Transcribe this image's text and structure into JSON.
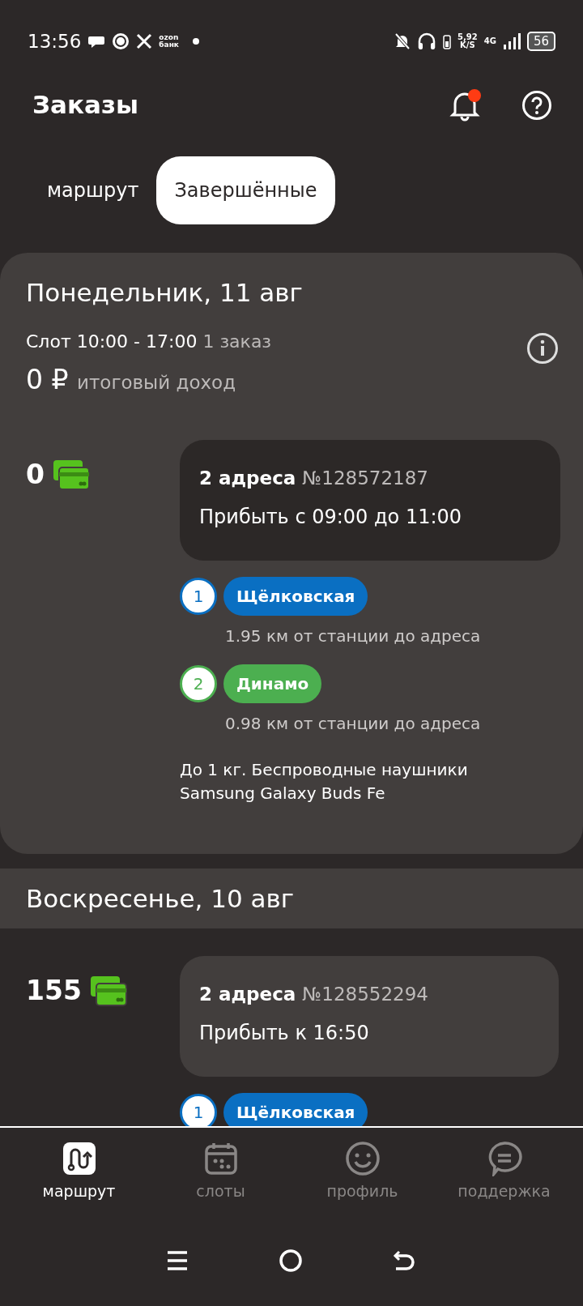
{
  "status_bar": {
    "time": "13:56",
    "bank_label": "ozon банк",
    "net_speed": "5,92",
    "net_speed_unit": "K/S",
    "network": "4G",
    "battery": "56"
  },
  "header": {
    "title": "Заказы",
    "notification_dot": true
  },
  "tabs": [
    {
      "label": "маршрут",
      "selected": false
    },
    {
      "label": "Завершённые",
      "selected": true
    }
  ],
  "days": [
    {
      "date": "Понедельник, 11 авг",
      "highlighted": true,
      "slot": "Слот 10:00 - 17:00",
      "order_count": "1 заказ",
      "income": "0 ₽",
      "income_label": "итоговый доход",
      "orders": [
        {
          "amount": "0",
          "addresses": "2 адреса",
          "number": "№128572187",
          "arrival": "Прибыть с 09:00 до 11:00",
          "stops": [
            {
              "index": "1",
              "station": "Щёлковская",
              "color": "#0a6fc2",
              "distance": "1.95 км от станции до адреса"
            },
            {
              "index": "2",
              "station": "Динамо",
              "color": "#4caf50",
              "distance": "0.98 км от станции до адреса"
            }
          ],
          "description": "До 1 кг. Беспроводные наушники Samsung Galaxy Buds Fe"
        }
      ]
    },
    {
      "date": "Воскресенье, 10 авг",
      "highlighted": false,
      "orders": [
        {
          "amount": "155",
          "addresses": "2 адреса",
          "number": "№128552294",
          "arrival": "Прибыть к 16:50",
          "stops": [
            {
              "index": "1",
              "station": "Щёлковская",
              "color": "#0a6fc2"
            }
          ]
        }
      ]
    }
  ],
  "bottom_nav": [
    {
      "kind": "route",
      "label": "маршрут",
      "selected": true
    },
    {
      "kind": "calendar",
      "label": "слоты",
      "selected": false
    },
    {
      "kind": "smile",
      "label": "профиль",
      "selected": false
    },
    {
      "kind": "chat",
      "label": "поддержка",
      "selected": false
    }
  ]
}
